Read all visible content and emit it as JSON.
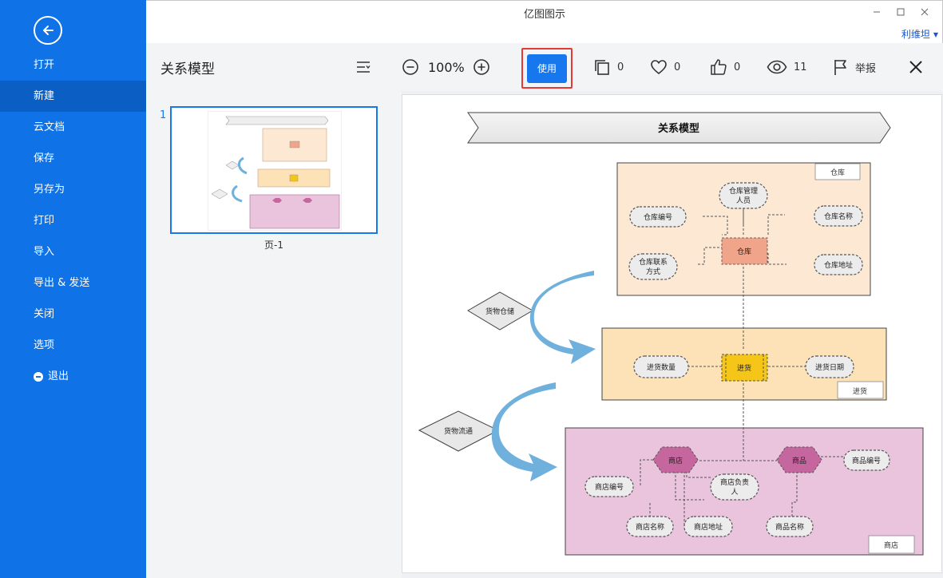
{
  "window": {
    "title": "亿图图示",
    "user": "利维坦"
  },
  "sidebar": {
    "items": [
      {
        "label": "打开"
      },
      {
        "label": "新建"
      },
      {
        "label": "云文档"
      },
      {
        "label": "保存"
      },
      {
        "label": "另存为"
      },
      {
        "label": "打印"
      },
      {
        "label": "导入"
      },
      {
        "label": "导出 & 发送"
      },
      {
        "label": "关闭"
      },
      {
        "label": "选项"
      },
      {
        "label": "退出"
      }
    ],
    "active": "新建"
  },
  "toolbar": {
    "doc_title": "关系模型",
    "zoom": "100%",
    "use_label": "使用",
    "copies": "0",
    "likes": "0",
    "thumbs": "0",
    "views": "11",
    "report_label": "举报"
  },
  "thumbnails": {
    "page_number": "1",
    "page_label": "页-1"
  },
  "diagram": {
    "title": "关系模型",
    "groups": {
      "warehouse": "仓库",
      "purchase": "进货",
      "shop": "商店"
    },
    "nodes": {
      "warehouse_center": "仓库",
      "manager": [
        "仓库管理",
        "人员"
      ],
      "wh_id": "仓库编号",
      "wh_name": "仓库名称",
      "wh_contact": [
        "仓库联系",
        "方式"
      ],
      "wh_addr": "仓库地址",
      "purchase_center": "进货",
      "qty": "进货数量",
      "date": "进货日期",
      "shop_center": "商店",
      "goods_center": "商品",
      "shop_owner": [
        "商店负责",
        "人"
      ],
      "goods_id": "商品编号",
      "shop_id": "商店编号",
      "shop_name": "商店名称",
      "shop_addr": "商店地址",
      "goods_name": "商品名称"
    },
    "relations": {
      "storage": "货物仓储",
      "flow": "货物流通"
    }
  },
  "colors": {
    "sidebar": "#0f72e6",
    "accent": "#1677ef",
    "highlight": "#e53935",
    "warehouse_bg": "#fde9d3",
    "purchase_bg": "#fde2b8",
    "shop_bg": "#eac3dc"
  }
}
